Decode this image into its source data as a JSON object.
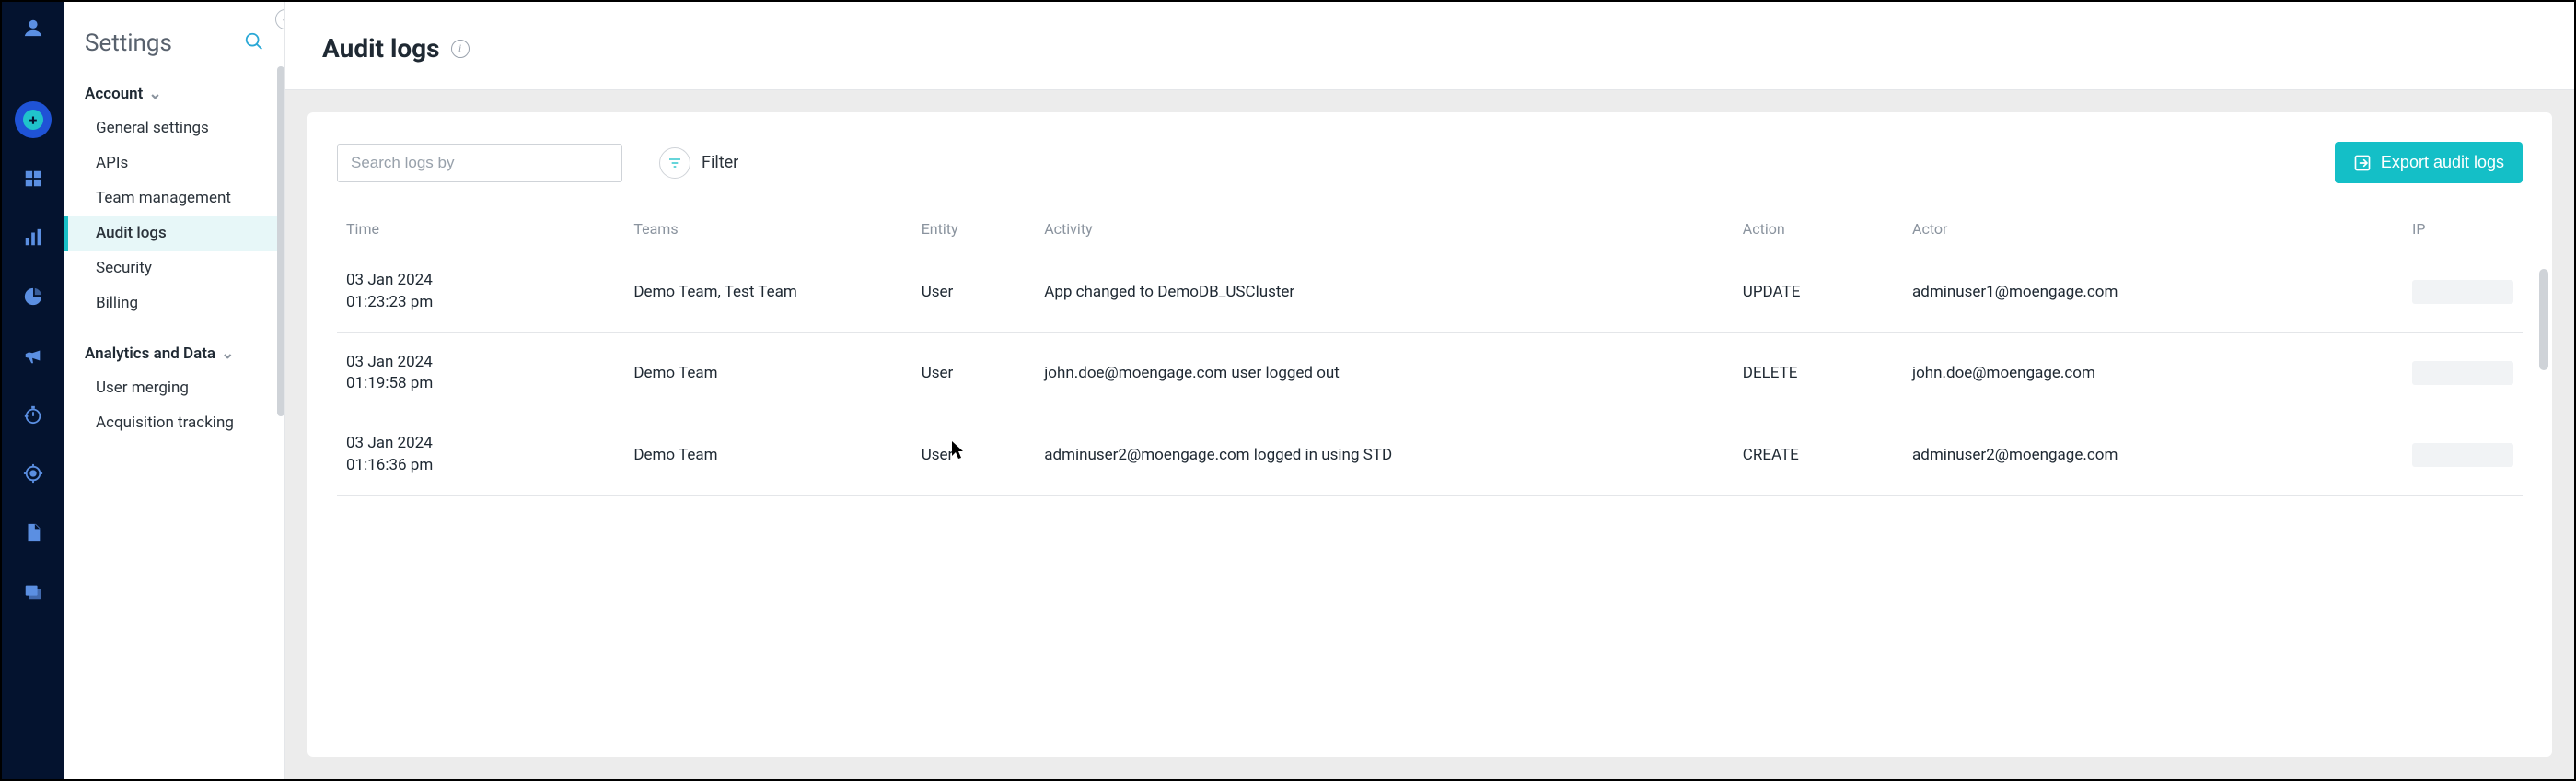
{
  "settings": {
    "title": "Settings",
    "sections": [
      {
        "label": "Account",
        "items": [
          "General settings",
          "APIs",
          "Team management",
          "Audit logs",
          "Security",
          "Billing"
        ],
        "active_index": 3
      },
      {
        "label": "Analytics and Data",
        "items": [
          "User merging",
          "Acquisition tracking"
        ]
      }
    ]
  },
  "page": {
    "title": "Audit logs"
  },
  "toolbar": {
    "search_placeholder": "Search logs by",
    "filter_label": "Filter",
    "export_label": "Export audit logs"
  },
  "table": {
    "columns": [
      "Time",
      "Teams",
      "Entity",
      "Activity",
      "Action",
      "Actor",
      "IP"
    ],
    "rows": [
      {
        "time": "03 Jan 2024\n01:23:23 pm",
        "teams": "Demo Team, Test Team",
        "entity": "User",
        "activity": "App changed to DemoDB_USCluster",
        "action": "UPDATE",
        "actor": "adminuser1@moengage.com"
      },
      {
        "time": "03 Jan 2024\n01:19:58 pm",
        "teams": "Demo Team",
        "entity": "User",
        "activity": "john.doe@moengage.com user logged out",
        "action": "DELETE",
        "actor": "john.doe@moengage.com"
      },
      {
        "time": "03 Jan 2024\n01:16:36 pm",
        "teams": "Demo Team",
        "entity": "User",
        "activity": "adminuser2@moengage.com logged in using STD",
        "action": "CREATE",
        "actor": "adminuser2@moengage.com"
      }
    ]
  }
}
